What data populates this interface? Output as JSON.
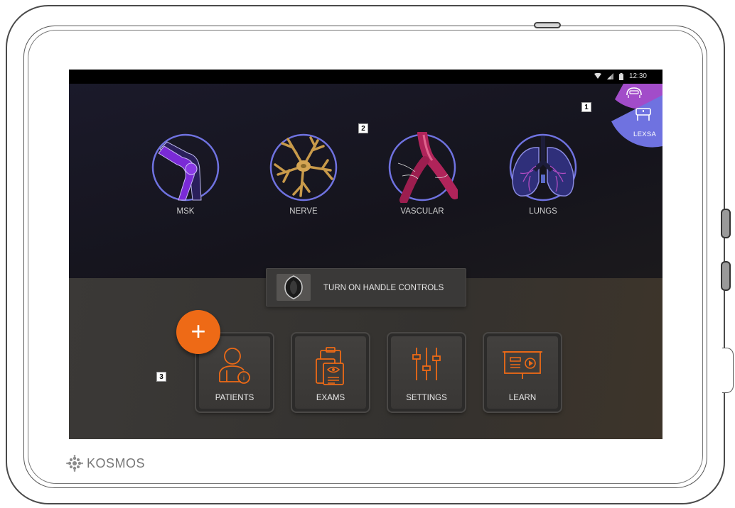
{
  "status_bar": {
    "time": "12:30"
  },
  "probe_selector": {
    "active_label": "LEXSA"
  },
  "apps": [
    {
      "label": "MSK",
      "icon": "knee-joint-icon"
    },
    {
      "label": "NERVE",
      "icon": "nerve-cell-icon"
    },
    {
      "label": "VASCULAR",
      "icon": "blood-vessel-icon"
    },
    {
      "label": "LUNGS",
      "icon": "lungs-icon"
    }
  ],
  "handle_controls": {
    "label": "TURN ON HANDLE CONTROLS",
    "icon": "probe-handle-icon"
  },
  "menu": [
    {
      "label": "PATIENTS",
      "icon": "patient-icon"
    },
    {
      "label": "EXAMS",
      "icon": "exams-icon"
    },
    {
      "label": "SETTINGS",
      "icon": "sliders-icon"
    },
    {
      "label": "LEARN",
      "icon": "presentation-play-icon"
    }
  ],
  "fab": {
    "symbol": "+"
  },
  "callouts": [
    "1",
    "2",
    "3"
  ],
  "brand": {
    "name": "KOSMOS"
  },
  "colors": {
    "accent": "#ee6a16",
    "ring": "#6f72e0",
    "probe_purple": "#a24cc9",
    "probe_blue": "#6f72e0"
  }
}
